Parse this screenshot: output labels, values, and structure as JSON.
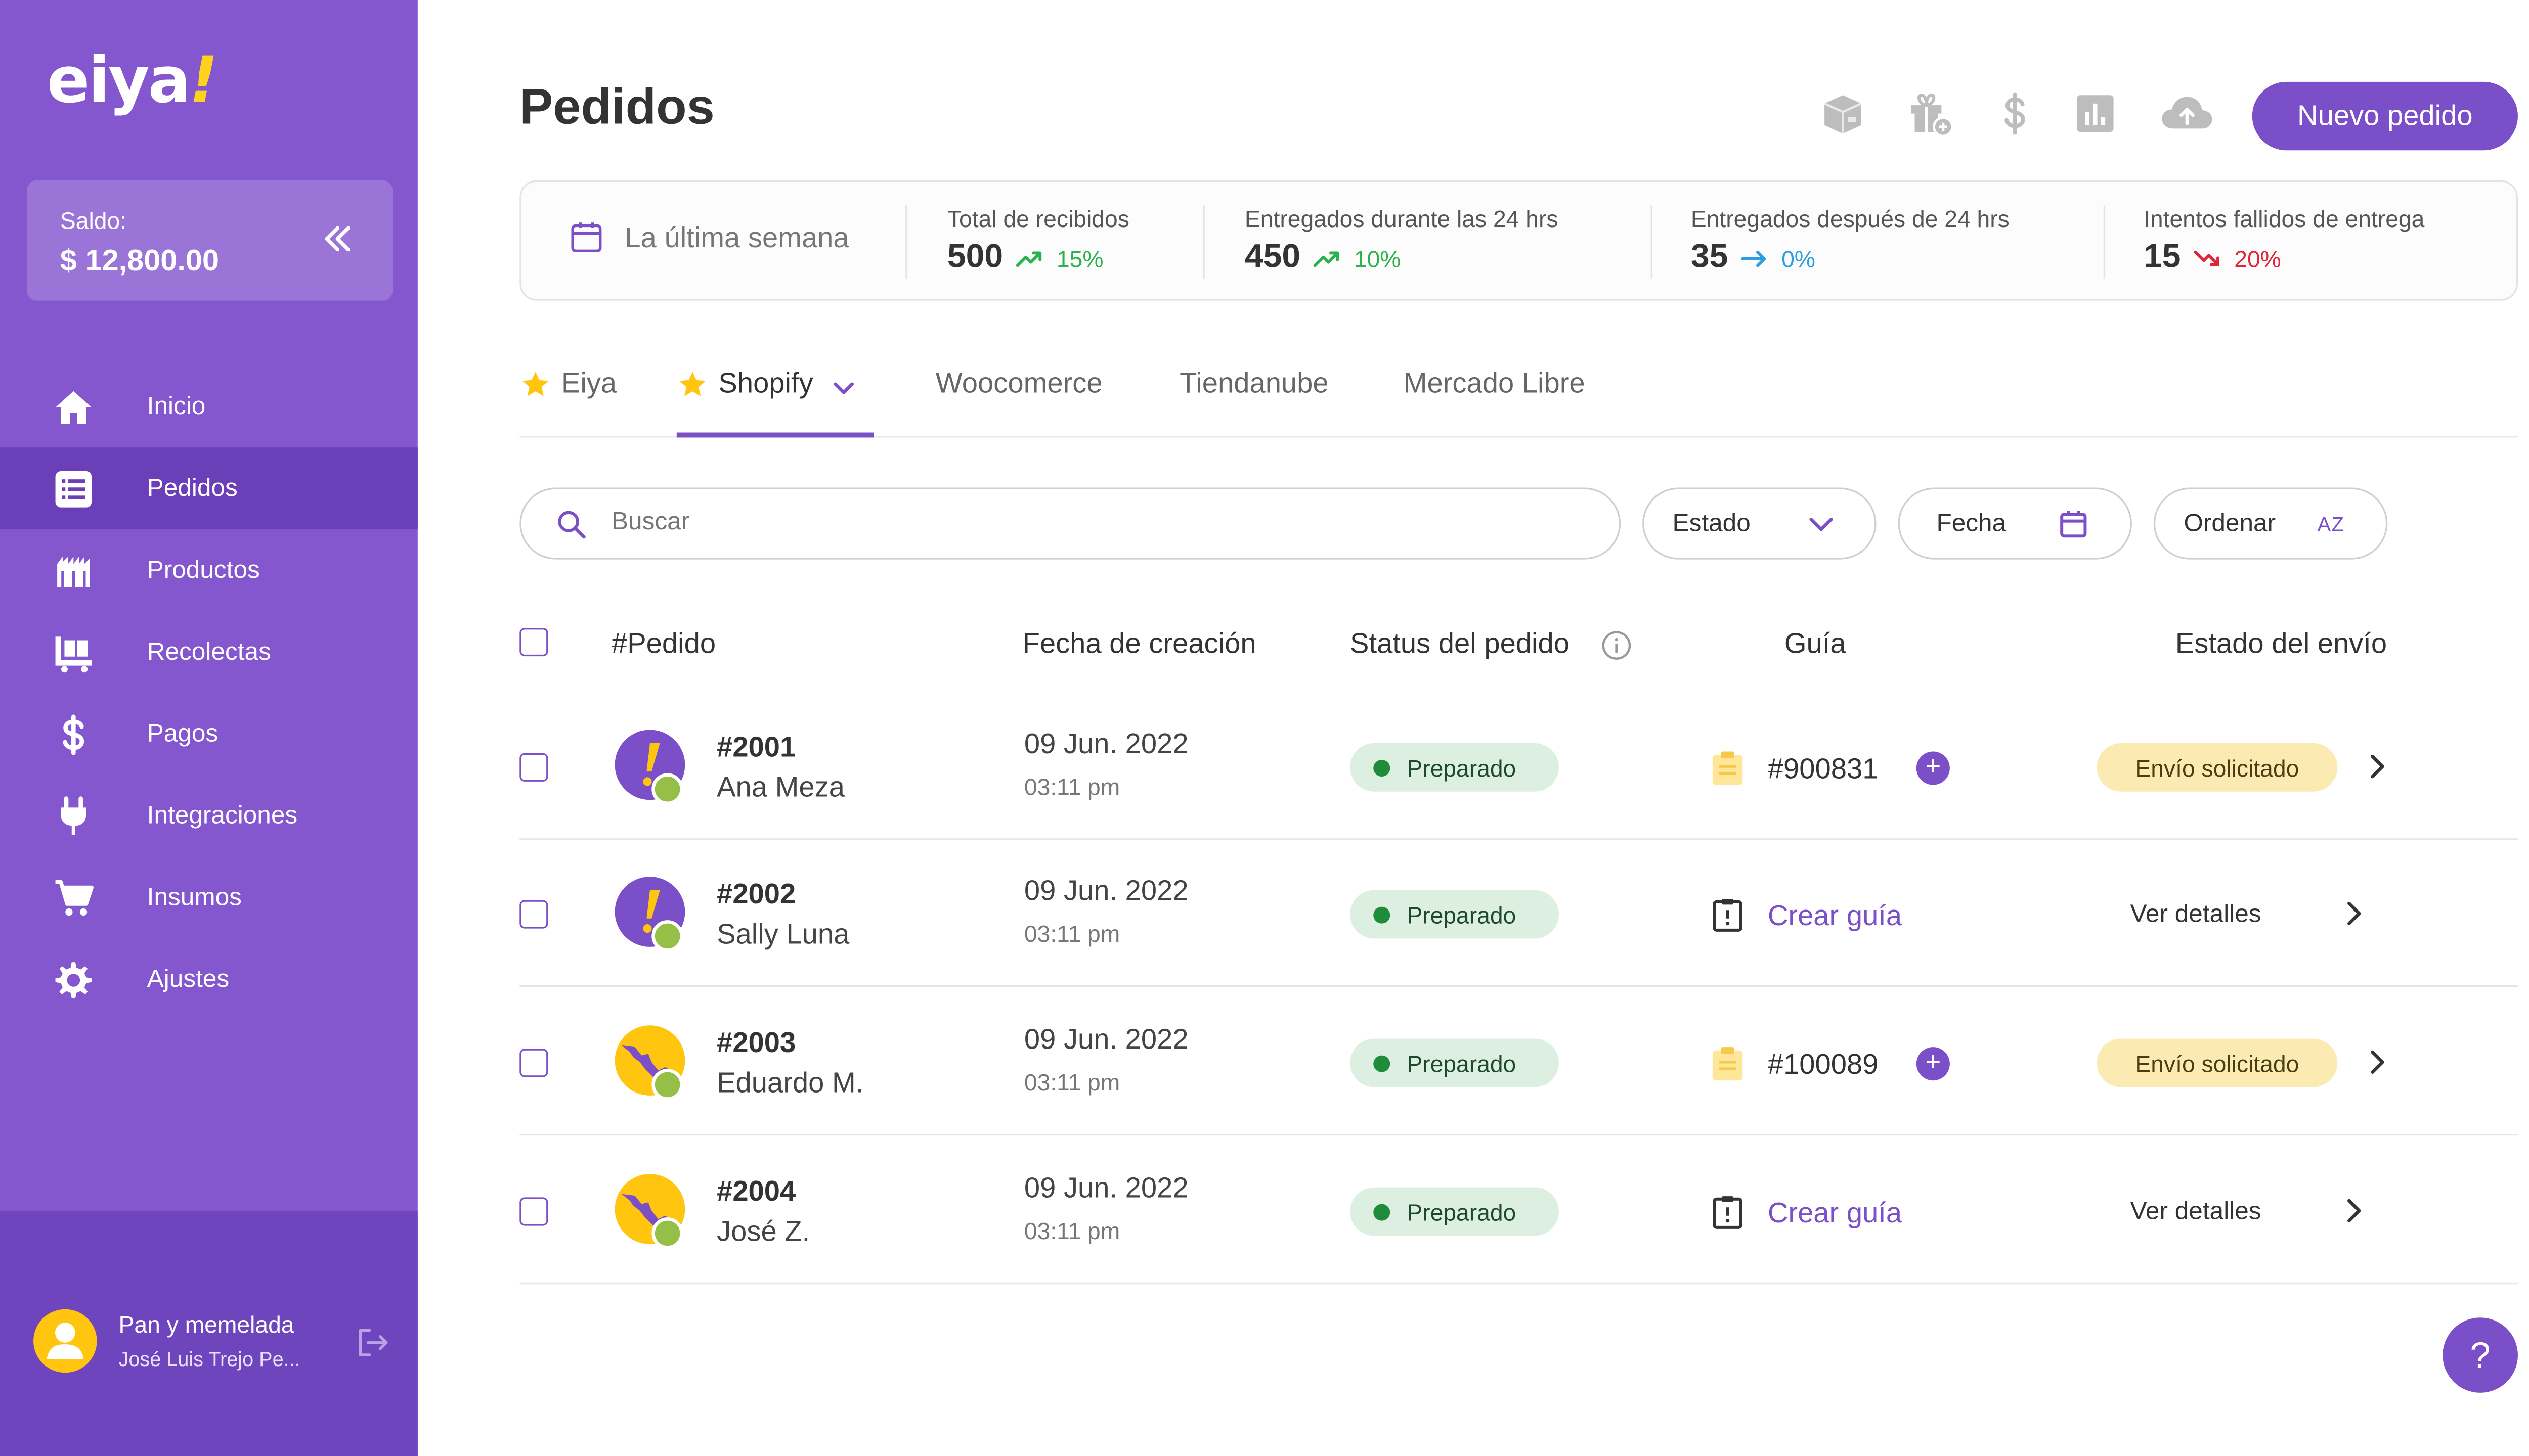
{
  "sidebar": {
    "logo": "eiya",
    "logo_mark": "!",
    "balance_label": "Saldo:",
    "balance_value": "$ 12,800.00",
    "items": [
      {
        "label": "Inicio",
        "icon": "home-icon"
      },
      {
        "label": "Pedidos",
        "icon": "orders-list-icon",
        "active": true
      },
      {
        "label": "Productos",
        "icon": "products-icon"
      },
      {
        "label": "Recolectas",
        "icon": "pickups-icon"
      },
      {
        "label": "Pagos",
        "icon": "dollar-icon"
      },
      {
        "label": "Integraciones",
        "icon": "plug-icon"
      },
      {
        "label": "Insumos",
        "icon": "cart-icon"
      },
      {
        "label": "Ajustes",
        "icon": "gear-icon"
      }
    ],
    "user": {
      "store": "Pan y memelada",
      "name": "José Luis Trejo Pe..."
    }
  },
  "header": {
    "title": "Pedidos",
    "toolbar_icons": [
      "package-icon",
      "gift-icon",
      "dollar-icon",
      "bar-chart-icon",
      "cloud-upload-icon"
    ],
    "new_order_label": "Nuevo pedido"
  },
  "stats": {
    "period": "La última semana",
    "items": [
      {
        "label": "Total de recibidos",
        "value": "500",
        "trend": "15%",
        "direction": "up",
        "color": "#2bb24c"
      },
      {
        "label": "Entregados durante las 24 hrs",
        "value": "450",
        "trend": "10%",
        "direction": "up",
        "color": "#2bb24c"
      },
      {
        "label": "Entregados después de 24 hrs",
        "value": "35",
        "trend": "0%",
        "direction": "flat",
        "color": "#2a9ee0"
      },
      {
        "label": "Intentos fallidos de entrega",
        "value": "15",
        "trend": "20%",
        "direction": "down",
        "color": "#e0243a"
      }
    ]
  },
  "tabs": [
    {
      "label": "Eiya",
      "starred": true
    },
    {
      "label": "Shopify",
      "starred": true,
      "active": true,
      "dropdown": true
    },
    {
      "label": "Woocomerce"
    },
    {
      "label": "Tiendanube"
    },
    {
      "label": "Mercado Libre"
    }
  ],
  "filters": {
    "search_placeholder": "Buscar",
    "estado": "Estado",
    "fecha": "Fecha",
    "ordenar": "Ordenar",
    "sort_icon_text": "AZ"
  },
  "table": {
    "headers": {
      "order": "#Pedido",
      "created": "Fecha de creación",
      "status": "Status del pedido",
      "guide": "Guía",
      "shipping": "Estado del envío"
    },
    "rows": [
      {
        "order": "#2001",
        "customer": "Ana Meza",
        "date": "09 Jun. 2022",
        "time": "03:11 pm",
        "status": "Preparado",
        "guide": "#900831",
        "shipping": "Envío solicitado",
        "avatar": "eiya"
      },
      {
        "order": "#2002",
        "customer": "Sally Luna",
        "date": "09 Jun. 2022",
        "time": "03:11 pm",
        "status": "Preparado",
        "guide_action": "Crear guía",
        "shipping_action": "Ver detalles",
        "avatar": "eiya"
      },
      {
        "order": "#2003",
        "customer": "Eduardo M.",
        "date": "09 Jun. 2022",
        "time": "03:11 pm",
        "status": "Preparado",
        "guide": "#100089",
        "shipping": "Envío solicitado",
        "avatar": "mexico"
      },
      {
        "order": "#2004",
        "customer": "José Z.",
        "date": "09 Jun. 2022",
        "time": "03:11 pm",
        "status": "Preparado",
        "guide_action": "Crear guía",
        "shipping_action": "Ver detalles",
        "avatar": "mexico"
      }
    ]
  },
  "help_label": "?",
  "colors": {
    "primary": "#7a4fc8",
    "sidebar": "#8457cf",
    "sidebar_active": "#6b3fb8",
    "accent_yellow": "#ffc50f"
  }
}
